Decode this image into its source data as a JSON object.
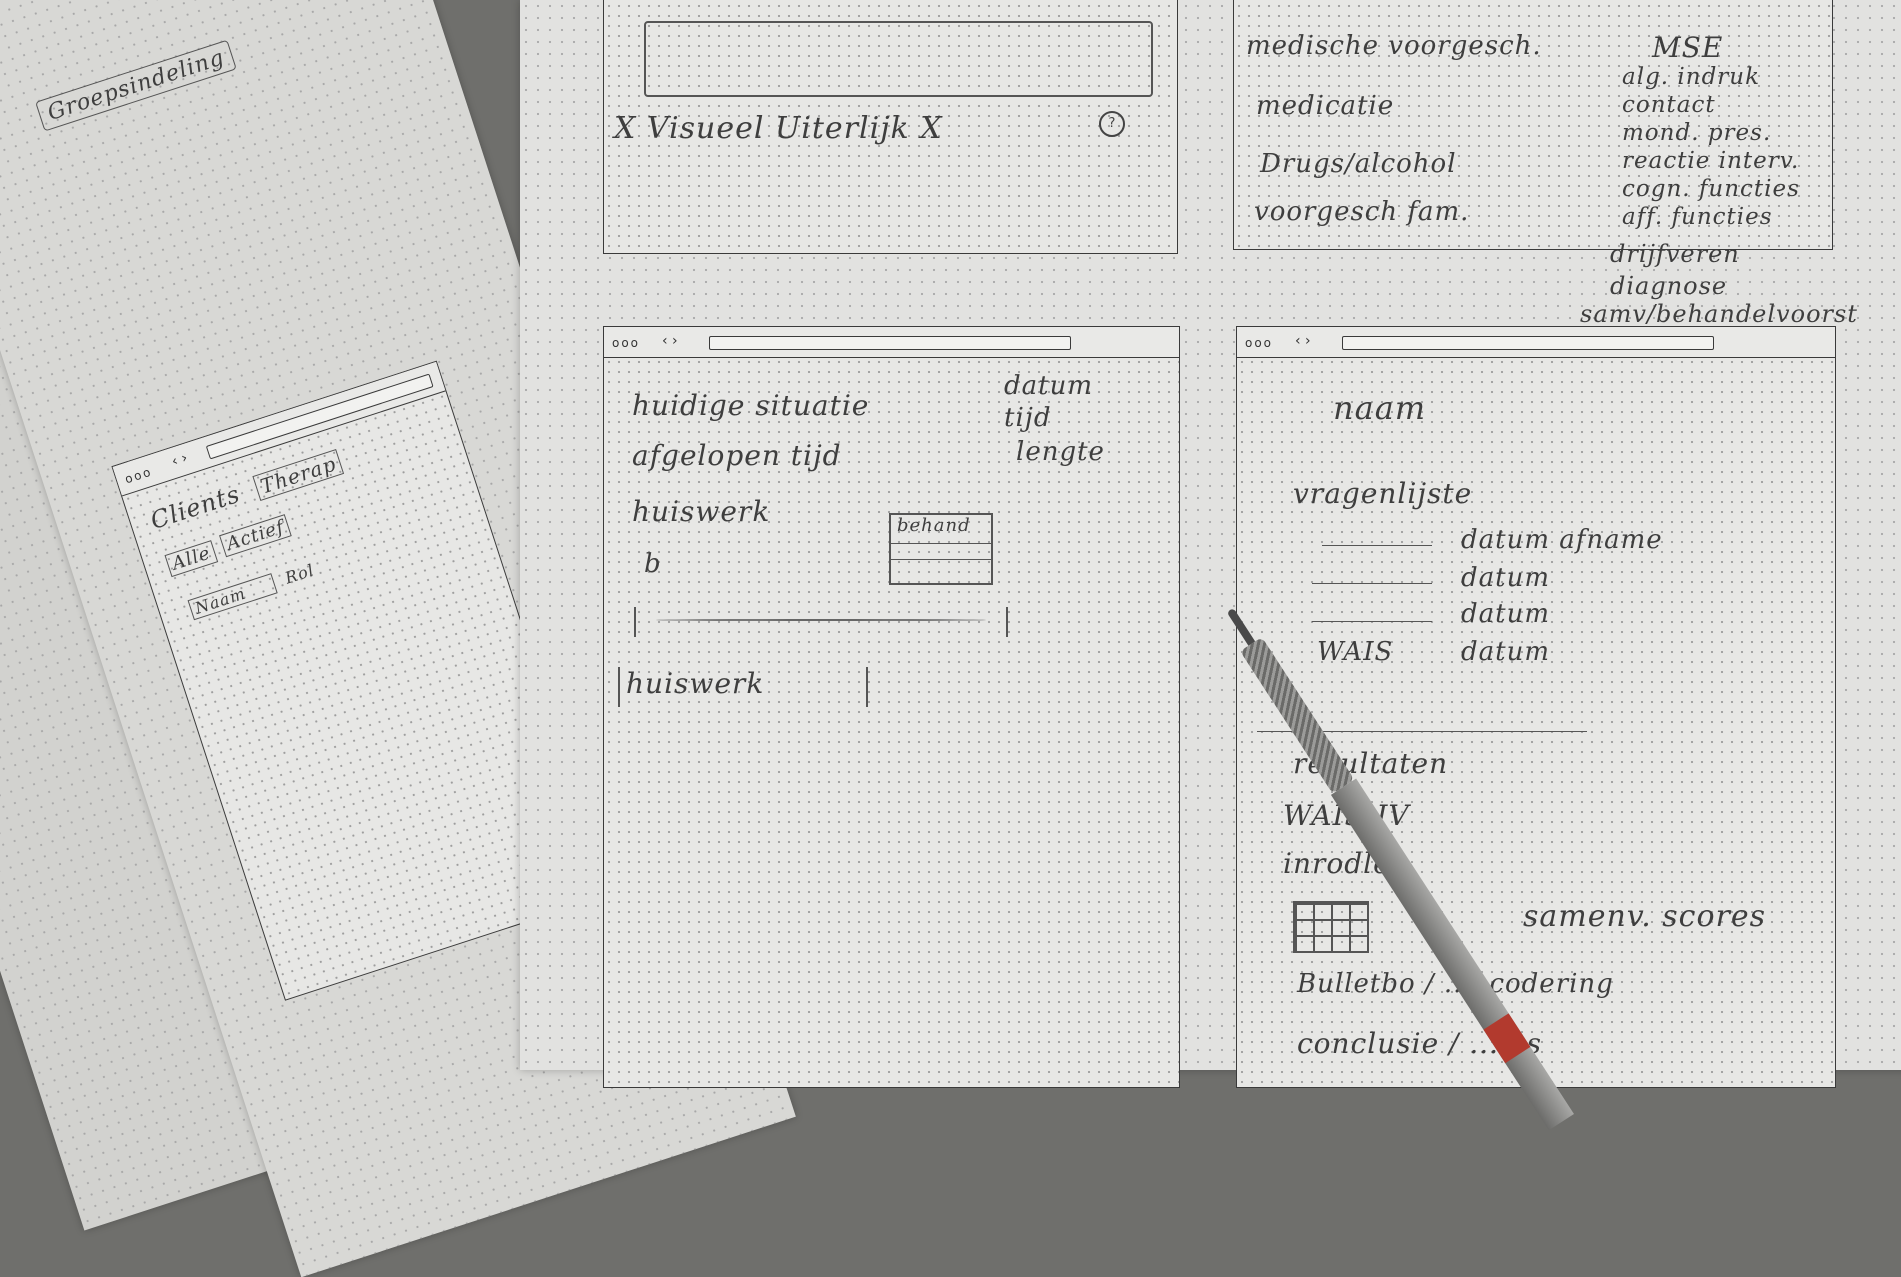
{
  "top_left_sketch": {
    "label_row": "X Visueel Uiterlijk X",
    "info_icon": "info-circle-icon"
  },
  "top_right_sketch": {
    "items": [
      "medische voorgesch.",
      "medicatie",
      "Drugs/alcohol",
      "voorgesch fam."
    ],
    "mse_title": "MSE",
    "mse_items": [
      "alg. indruk",
      "contact",
      "mond. pres.",
      "reactie interv.",
      "cogn. functies",
      "aff. functies"
    ],
    "below": [
      "drijfveren",
      "diagnose",
      "samv/behandelvoorst"
    ]
  },
  "middle_sketch": {
    "lines": [
      "huidige situatie",
      "afgelopen tijd",
      "huiswerk",
      "b"
    ],
    "right_column": [
      "datum",
      "tijd",
      "lengte"
    ],
    "badge_label": "behand",
    "input_label": "huiswerk"
  },
  "right_sketch": {
    "name_label": "naam",
    "section_title": "vragenlijste",
    "rows": [
      {
        "name": "",
        "value": "datum afname"
      },
      {
        "name": "",
        "value": "datum"
      },
      {
        "name": "",
        "value": "datum"
      },
      {
        "name": "WAIS",
        "value": "datum"
      }
    ],
    "lower": [
      "resultaten",
      "WAIS-IV",
      "inrodle",
      "samenv. scores",
      "Bulletbo / ...ncodering",
      "conclusie / ...ies"
    ]
  },
  "left_sheets": {
    "tab_labels": [
      "Clients",
      "Therap"
    ],
    "filter_labels": [
      "Alle",
      "Actief"
    ],
    "column_labels": [
      "Naam",
      "Rol"
    ],
    "top_label": "Groepsindeling"
  },
  "pencil": {
    "brand_color": "#c0392b",
    "body_color": "#8f8f8d"
  }
}
